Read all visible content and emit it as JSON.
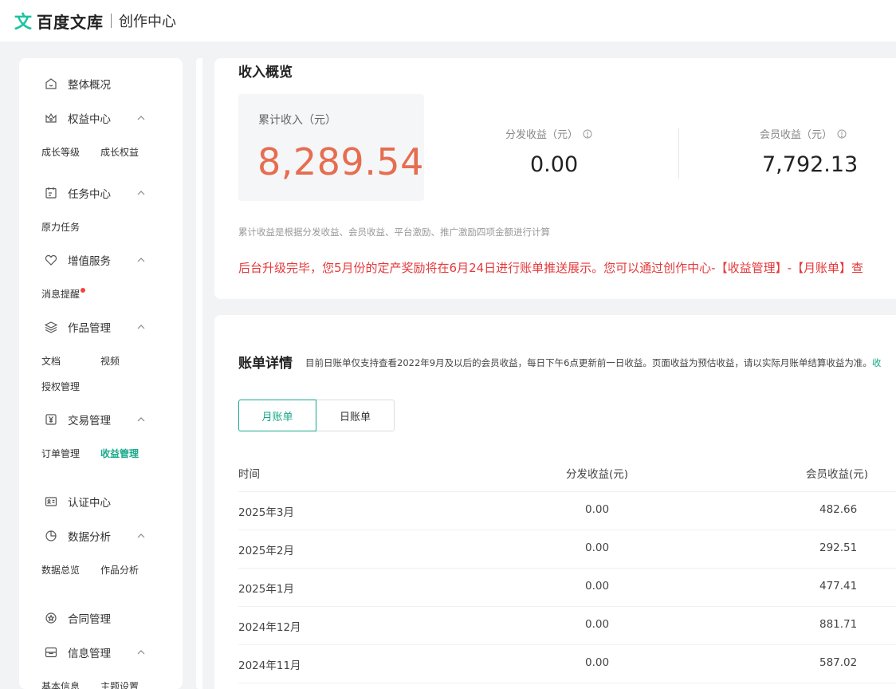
{
  "header": {
    "logo_mark": "文",
    "logo_text": "百度文库",
    "subtitle": "创作中心"
  },
  "sidebar": {
    "overview": "整体概况",
    "rights_center": "权益中心",
    "growth_level": "成长等级",
    "growth_rights": "成长权益",
    "task_center": "任务中心",
    "yuanli_task": "原力任务",
    "value_added": "增值服务",
    "message_alert": "消息提醒",
    "works_management": "作品管理",
    "doc": "文档",
    "video": "视频",
    "authorization": "授权管理",
    "trade_management": "交易管理",
    "order_management": "订单管理",
    "income_management": "收益管理",
    "certification": "认证中心",
    "data_analysis": "数据分析",
    "data_overview": "数据总览",
    "works_analysis": "作品分析",
    "contract_management": "合同管理",
    "info_management": "信息管理",
    "basic_info": "基本信息",
    "topic_settings": "主题设置"
  },
  "income_overview": {
    "title": "收入概览",
    "total_label": "累计收入（元）",
    "total_value": "8,289.54",
    "distribution_label": "分发收益（元）",
    "distribution_value": "0.00",
    "member_label": "会员收益（元）",
    "member_value": "7,792.13",
    "note": "累计收益是根据分发收益、会员收益、平台激励、推广激励四项金额进行计算",
    "notice": "后台升级完毕，您5月份的定产奖励将在6月24日进行账单推送展示。您可以通过创作中心-【收益管理】-【月账单】查"
  },
  "bill_details": {
    "title": "账单详情",
    "description": "目前日账单仅支持查看2022年9月及以后的会员收益，每日下午6点更新前一日收益。页面收益为预估收益，请以实际月账单结算收益为准。",
    "description_link": "收",
    "tab_monthly": "月账单",
    "tab_daily": "日账单",
    "col_time": "时间",
    "col_distribution": "分发收益(元)",
    "col_member": "会员收益(元)",
    "rows": [
      {
        "time": "2025年3月",
        "distribution": "0.00",
        "member": "482.66"
      },
      {
        "time": "2025年2月",
        "distribution": "0.00",
        "member": "292.51"
      },
      {
        "time": "2025年1月",
        "distribution": "0.00",
        "member": "477.41"
      },
      {
        "time": "2024年12月",
        "distribution": "0.00",
        "member": "881.71"
      },
      {
        "time": "2024年11月",
        "distribution": "0.00",
        "member": "587.02"
      }
    ]
  },
  "colors": {
    "accent": "#19a88a",
    "total_value": "#e66d50",
    "notice": "#e4393c",
    "badge": "#f5423d"
  }
}
